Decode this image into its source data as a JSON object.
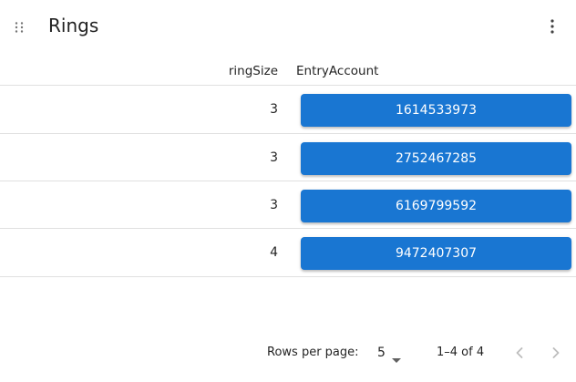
{
  "header": {
    "title": "Rings",
    "drag_icon": "drag-handle-icon",
    "menu_icon": "more-vertical-icon"
  },
  "table": {
    "columns": [
      "ringSize",
      "EntryAccount"
    ],
    "rows": [
      {
        "ringSize": "3",
        "entryAccount": "1614533973"
      },
      {
        "ringSize": "3",
        "entryAccount": "2752467285"
      },
      {
        "ringSize": "3",
        "entryAccount": "6169799592"
      },
      {
        "ringSize": "4",
        "entryAccount": "9472407307"
      }
    ]
  },
  "pagination": {
    "rows_per_page_label": "Rows per page:",
    "rows_per_page_value": "5",
    "range_text": "1–4 of 4",
    "prev_icon": "chevron-left-icon",
    "next_icon": "chevron-right-icon"
  },
  "colors": {
    "button": "#1976d2",
    "divider": "#e0e0e0",
    "disabled_icon": "#bdbdbd"
  }
}
